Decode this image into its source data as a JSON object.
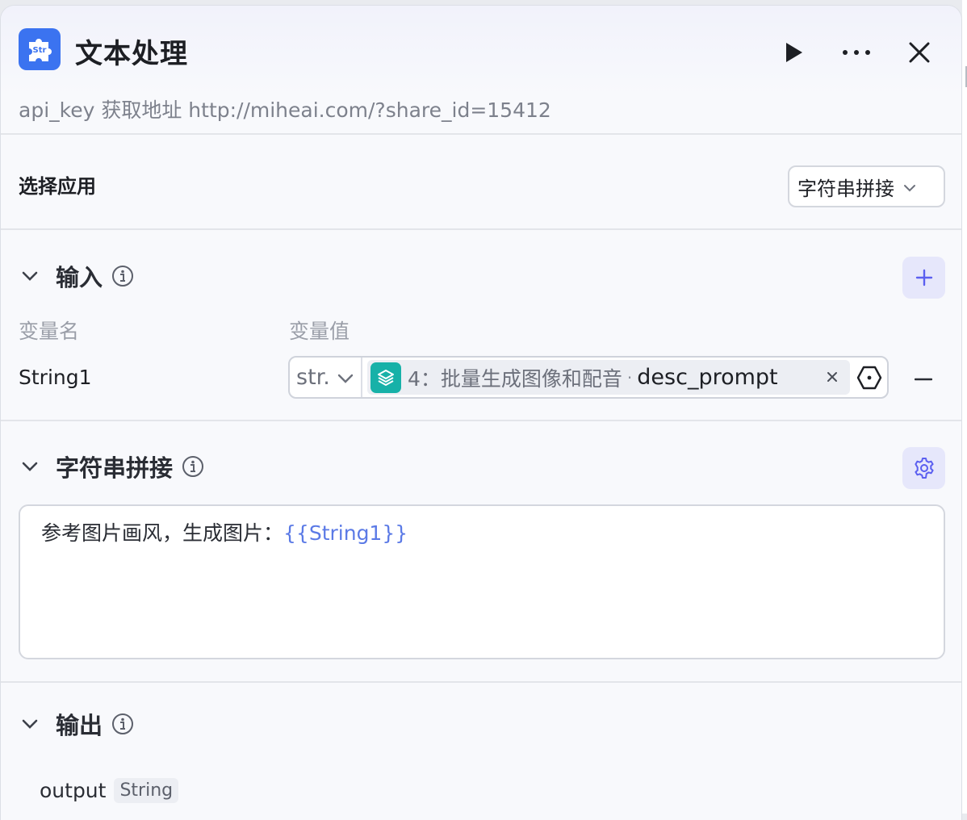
{
  "header": {
    "title": "文本处理",
    "description": "api_key 获取地址  http://miheai.com/?share_id=15412"
  },
  "app_select": {
    "label": "选择应用",
    "value": "字符串拼接"
  },
  "input_section": {
    "title": "输入",
    "col_name": "变量名",
    "col_value": "变量值",
    "variables": [
      {
        "name": "String1",
        "type": "str.",
        "ref_node": "4：批量生成图像和配音",
        "ref_sep": "·",
        "ref_var": "desc_prompt"
      }
    ]
  },
  "concat_section": {
    "title": "字符串拼接",
    "template_text": "参考图片画风，生成图片：",
    "template_var": "{{String1}}"
  },
  "output_section": {
    "title": "输出",
    "outputs": [
      {
        "name": "output",
        "type": "String"
      }
    ]
  },
  "colors": {
    "accent": "#5b5ff0",
    "app_icon": "#3b73f0",
    "ref_icon": "#17b1a8",
    "var_ref": "#5b7ae6"
  },
  "icons": {
    "app": "puzzle-str-icon",
    "run": "play-icon",
    "more": "ellipsis-icon",
    "close": "close-icon"
  }
}
